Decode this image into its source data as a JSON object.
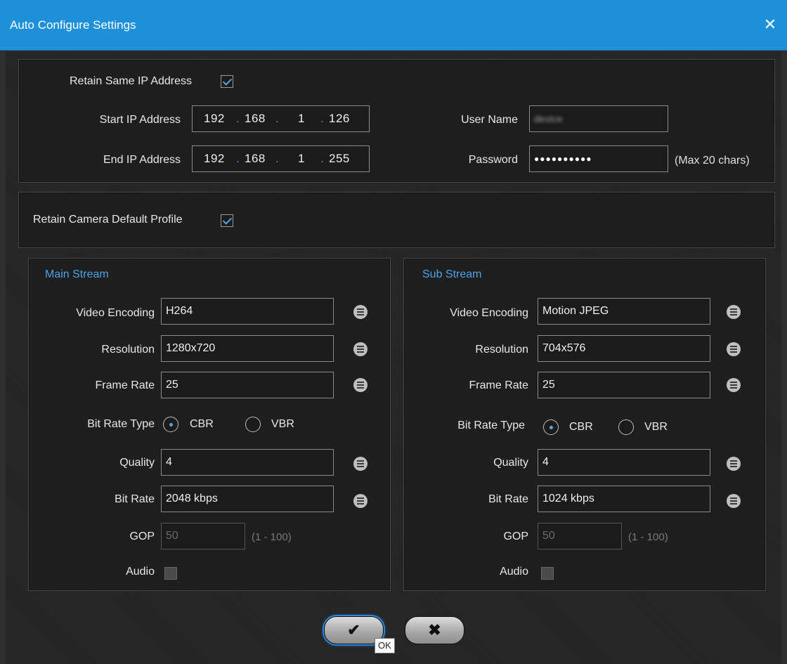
{
  "window": {
    "title": "Auto Configure Settings",
    "close_glyph": "✕"
  },
  "network": {
    "retain_ip_label": "Retain Same IP Address",
    "retain_ip_checked": true,
    "start_ip_label": "Start IP Address",
    "start_ip": [
      "192",
      "168",
      "1",
      "126"
    ],
    "end_ip_label": "End IP Address",
    "end_ip": [
      "192",
      "168",
      "1",
      "255"
    ],
    "user_name_label": "User Name",
    "user_name_value": "device",
    "password_label": "Password",
    "password_value": "●●●●●●●●●●",
    "password_hint": "(Max 20 chars)"
  },
  "profile": {
    "retain_default_label": "Retain Camera Default Profile",
    "retain_default_checked": true
  },
  "main_stream": {
    "title": "Main Stream",
    "video_encoding_label": "Video Encoding",
    "video_encoding": "H264",
    "resolution_label": "Resolution",
    "resolution": "1280x720",
    "frame_rate_label": "Frame Rate",
    "frame_rate": "25",
    "bit_rate_type_label": "Bit Rate Type",
    "cbr_label": "CBR",
    "vbr_label": "VBR",
    "bit_rate_type": "CBR",
    "quality_label": "Quality",
    "quality": "4",
    "bit_rate_label": "Bit Rate",
    "bit_rate": "2048 kbps",
    "gop_label": "GOP",
    "gop": "50",
    "gop_range": "(1 - 100)",
    "audio_label": "Audio",
    "audio_checked": false
  },
  "sub_stream": {
    "title": "Sub Stream",
    "video_encoding_label": "Video Encoding",
    "video_encoding": "Motion JPEG",
    "resolution_label": "Resolution",
    "resolution": "704x576",
    "frame_rate_label": "Frame Rate",
    "frame_rate": "25",
    "bit_rate_type_label": "Bit Rate Type",
    "cbr_label": "CBR",
    "vbr_label": "VBR",
    "bit_rate_type": "CBR",
    "quality_label": "Quality",
    "quality": "4",
    "bit_rate_label": "Bit Rate",
    "bit_rate": "1024 kbps",
    "gop_label": "GOP",
    "gop": "50",
    "gop_range": "(1 - 100)",
    "audio_label": "Audio",
    "audio_checked": false
  },
  "buttons": {
    "ok_glyph": "✔",
    "cancel_glyph": "✖",
    "ok_tooltip": "OK"
  },
  "colors": {
    "titlebar": "#1e8fd9",
    "accent": "#4aa3ea",
    "background": "#242424"
  },
  "icons": {
    "list": "list-icon",
    "close": "close-icon",
    "check": "checkmark-icon",
    "cross": "cross-icon"
  }
}
